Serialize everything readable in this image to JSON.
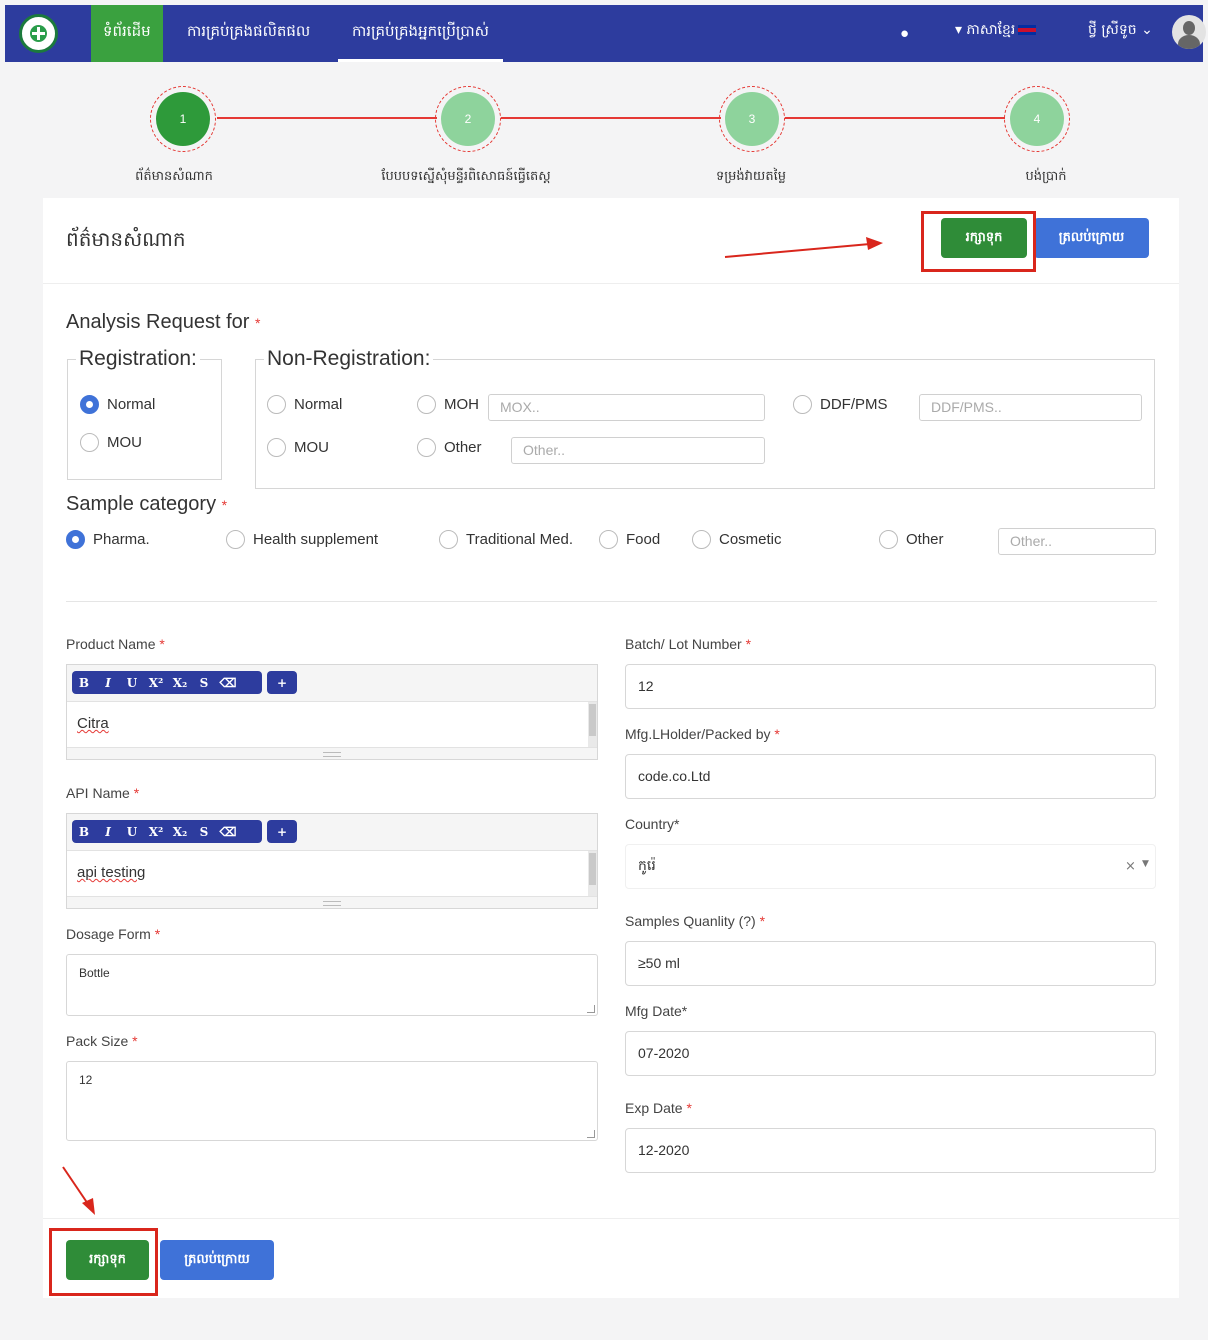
{
  "navbar": {
    "items": [
      "ទំព័រដើម",
      "ការគ្រប់គ្រងផលិតផល",
      "ការគ្រប់គ្រងអ្នកប្រើប្រាស់"
    ],
    "language": "ភាសាខ្មែរ",
    "user": "ថ្វី ស្រីទូច",
    "icons": [
      "logo",
      "bell-icon",
      "caret-down-icon",
      "flag-icon",
      "chevron-down-icon",
      "avatar"
    ]
  },
  "stepper": {
    "steps": [
      {
        "number": "1",
        "label": "ព័ត៌មានសំណាក"
      },
      {
        "number": "2",
        "label": "បែបបទស្នើសុំមន្ទីរពិសោធន៍ធ្វើតេស្ត"
      },
      {
        "number": "3",
        "label": "ទម្រង់វាយតម្លៃ"
      },
      {
        "number": "4",
        "label": "បង់ប្រាក់"
      }
    ],
    "current": 1
  },
  "card": {
    "title": "ព័ត៌មានសំណាក",
    "save_label": "រក្សាទុក",
    "back_label": "ត្រលប់ក្រោយ"
  },
  "analysis": {
    "label": "Analysis Request for",
    "required_mark": "*",
    "registration": {
      "legend": "Registration:",
      "options": [
        "Normal",
        "MOU"
      ],
      "selected": "Normal"
    },
    "non_registration": {
      "legend": "Non-Registration:",
      "options": [
        "Normal",
        "MOH",
        "DDF/PMS",
        "MOU",
        "Other"
      ],
      "placeholders": {
        "moh": "MOX..",
        "ddf": "DDF/PMS..",
        "other": "Other.."
      }
    }
  },
  "sample_category": {
    "label": "Sample category",
    "options": [
      "Pharma.",
      "Health supplement",
      "Traditional Med.",
      "Food",
      "Cosmetic",
      "Other"
    ],
    "selected": "Pharma.",
    "other_placeholder": "Other.."
  },
  "toolbar_buttons": [
    "B",
    "I",
    "U",
    "X²",
    "X₂",
    "S",
    "⌫",
    "+"
  ],
  "form": {
    "product_name": {
      "label": "Product Name",
      "value": "Citra"
    },
    "api_name": {
      "label": "API Name",
      "value": "api testing"
    },
    "dosage_form": {
      "label": "Dosage Form",
      "value": "Bottle"
    },
    "pack_size": {
      "label": "Pack Size",
      "value": "12"
    },
    "batch_lot": {
      "label": "Batch/ Lot Number",
      "value": "12"
    },
    "mfg_holder": {
      "label": "Mfg.LHolder/Packed by",
      "value": "code.co.Ltd"
    },
    "country": {
      "label": "Country*",
      "value": "កូរ៉េ"
    },
    "samples_quantity": {
      "label": "Samples Quanlity (?)",
      "value": "≥50 ml"
    },
    "mfg_date": {
      "label": "Mfg Date*",
      "value": "07-2020"
    },
    "exp_date": {
      "label": "Exp Date",
      "value": "12-2020"
    }
  },
  "colors": {
    "navbar": "#2d3c9e",
    "active_nav": "#3aa13f",
    "save_button": "#2f8c38",
    "back_button": "#3f72d8",
    "highlight": "#d9261c"
  }
}
